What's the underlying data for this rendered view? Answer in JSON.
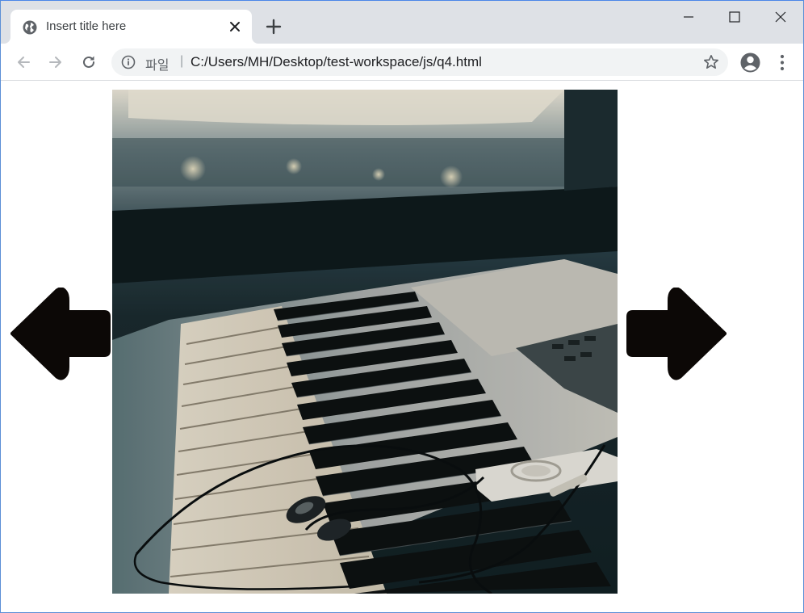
{
  "browser": {
    "tab": {
      "title": "Insert title here",
      "favicon": "globe-icon"
    },
    "address_bar": {
      "scheme_label": "파일",
      "separator": "|",
      "url": "C:/Users/MH/Desktop/test-workspace/js/q4.html"
    },
    "icons": {
      "back": "arrow-left-icon",
      "forward": "arrow-right-icon",
      "reload": "reload-icon",
      "info": "info-icon",
      "bookmark": "star-icon",
      "profile": "account-icon",
      "menu": "kebab-menu-icon",
      "minimize": "minimize-icon",
      "maximize": "maximize-icon",
      "close": "close-icon",
      "new_tab": "plus-icon"
    }
  },
  "page": {
    "image": {
      "subject": "piano-keyboard-with-earphones"
    },
    "controls": {
      "prev": "big-left-arrow-icon",
      "next": "big-right-arrow-icon"
    }
  },
  "colors": {
    "tabstrip": "#dee1e6",
    "omnibox": "#f1f3f4",
    "arrow": "#0c0806"
  }
}
